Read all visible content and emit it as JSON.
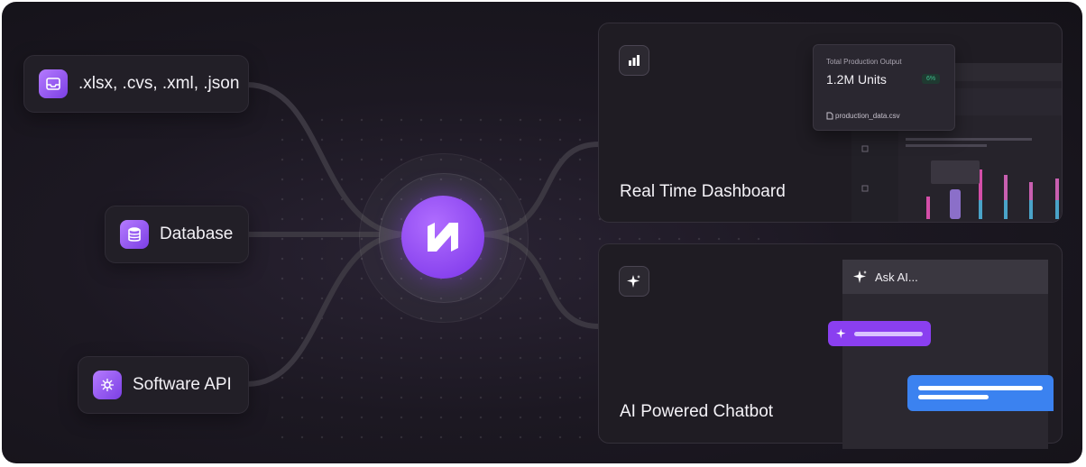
{
  "sources": [
    {
      "label": ".xlsx, .cvs, .xml, .json",
      "icon": "inbox-icon"
    },
    {
      "label": "Database",
      "icon": "database-icon"
    },
    {
      "label": "Software API",
      "icon": "api-network-icon"
    }
  ],
  "hub": {
    "icon": "n-logo-icon"
  },
  "outputs": {
    "dashboard": {
      "title": "Real Time Dashboard",
      "icon": "bar-chart-icon",
      "tooltip": {
        "label": "Total Production Output",
        "value": "1.2M Units",
        "badge": "6%",
        "file": "production_data.csv"
      }
    },
    "chatbot": {
      "title": "AI Powered Chatbot",
      "icon": "sparkle-icon",
      "prompt": "Ask AI..."
    }
  },
  "colors": {
    "accent": "#8a3ff0",
    "user_bubble": "#3b82f0",
    "background": "#18151c"
  }
}
